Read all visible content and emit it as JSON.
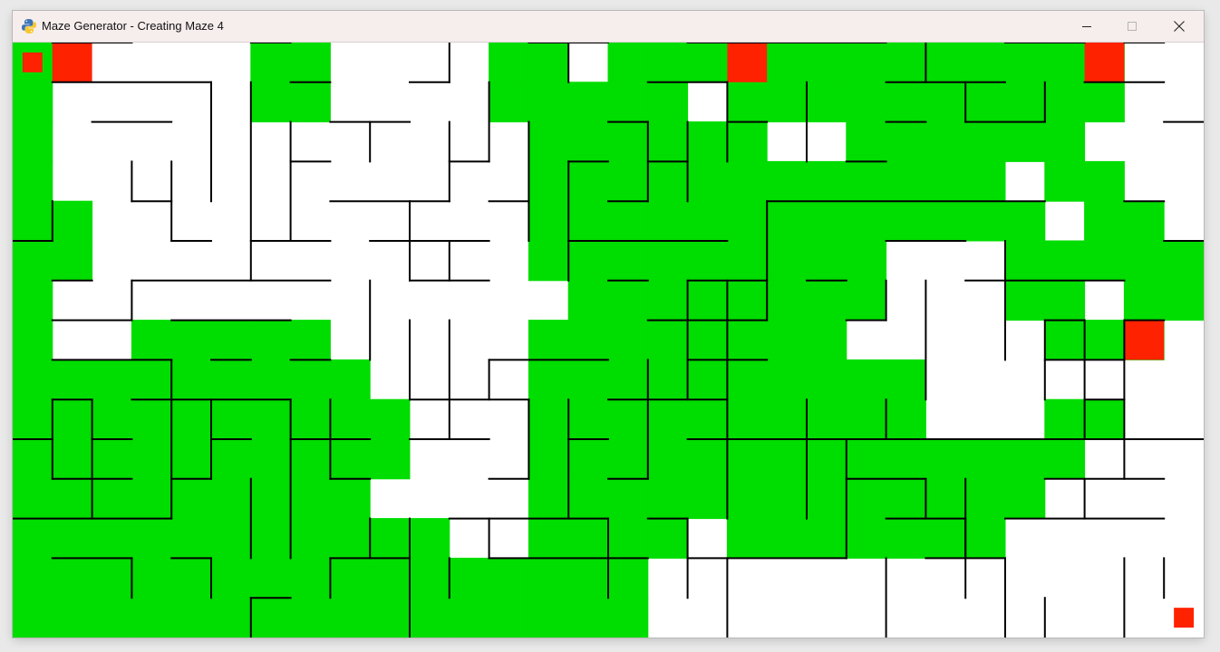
{
  "window": {
    "title": "Maze Generator - Creating Maze 4",
    "app_icon": "python-icon",
    "controls": [
      "minimize-icon",
      "maximize-icon",
      "close-icon"
    ]
  },
  "maze": {
    "columns": 30,
    "rows": 15,
    "colors": {
      "background": "#ffffff",
      "visited": "#00dd00",
      "marker": "#ff2200",
      "wall": "#000000"
    },
    "markers": [
      {
        "kind": "start",
        "col": 0,
        "row": 0,
        "size": "small"
      },
      {
        "kind": "cell",
        "col": 1,
        "row": 0,
        "size": "full"
      },
      {
        "kind": "cell",
        "col": 18,
        "row": 0,
        "size": "full"
      },
      {
        "kind": "cell",
        "col": 27,
        "row": 0,
        "size": "full"
      },
      {
        "kind": "cell",
        "col": 28,
        "row": 7,
        "size": "full"
      },
      {
        "kind": "end",
        "col": 29,
        "row": 14,
        "size": "small"
      }
    ],
    "visited_rows": [
      "G.....GG....GG.GGGGGGGGGGGGG..",
      "G.....GG....GGGGG.GGGGGGGGGG..",
      "G............GGGGGG..GGGGGG...",
      "G............GGGGGGGGGGGG.GG..",
      "GG...........GGGGGGGGGGGGG.GG.",
      "GG...........GGGGGGGGG...GGGGG",
      "G.............GGGGGGGG...GG.GG",
      "G..GGGGG.....GGGGGGGG.....GGG.",
      "GGGGGGGGG....GGGGGGGGGG.......",
      "GGGGGGGGGG...GGGGGGGGGG...GG..",
      "GGGGGGGGGG...GGGGGGGGGGGGGG...",
      "GGGGGGGGG....GGGGGGGGGGGGG....",
      "GGGGGGGGGGG..GGGG.GGGGGGG.....",
      "GGGGGGGGGGGGGGGG..............",
      "GGGGGGGGGGGGGGGG.............."
    ],
    "h_walls": [
      [
        1,
        0,
        3
      ],
      [
        6,
        0,
        7
      ],
      [
        13,
        0,
        15
      ],
      [
        17,
        0,
        20
      ],
      [
        20,
        0,
        22
      ],
      [
        25,
        0,
        27
      ],
      [
        28,
        0,
        29
      ],
      [
        1,
        1,
        5
      ],
      [
        7,
        1,
        8
      ],
      [
        10,
        1,
        11
      ],
      [
        16,
        1,
        18
      ],
      [
        22,
        1,
        25
      ],
      [
        27,
        1,
        29
      ],
      [
        2,
        2,
        4
      ],
      [
        8,
        2,
        10
      ],
      [
        15,
        2,
        16
      ],
      [
        18,
        2,
        19
      ],
      [
        22,
        2,
        23
      ],
      [
        24,
        2,
        26
      ],
      [
        29,
        2,
        30
      ],
      [
        7,
        3,
        8
      ],
      [
        11,
        3,
        12
      ],
      [
        14,
        3,
        15
      ],
      [
        16,
        3,
        17
      ],
      [
        21,
        3,
        22
      ],
      [
        3,
        4,
        4
      ],
      [
        8,
        4,
        11
      ],
      [
        12,
        4,
        13
      ],
      [
        15,
        4,
        16
      ],
      [
        19,
        4,
        26
      ],
      [
        28,
        4,
        29
      ],
      [
        0,
        5,
        1
      ],
      [
        4,
        5,
        5
      ],
      [
        6,
        5,
        8
      ],
      [
        9,
        5,
        12
      ],
      [
        14,
        5,
        18
      ],
      [
        22,
        5,
        24
      ],
      [
        29,
        5,
        30
      ],
      [
        1,
        6,
        2
      ],
      [
        3,
        6,
        8
      ],
      [
        10,
        6,
        12
      ],
      [
        15,
        6,
        16
      ],
      [
        17,
        6,
        19
      ],
      [
        20,
        6,
        21
      ],
      [
        24,
        6,
        28
      ],
      [
        1,
        7,
        3
      ],
      [
        4,
        7,
        7
      ],
      [
        16,
        7,
        19
      ],
      [
        21,
        7,
        22
      ],
      [
        26,
        7,
        27
      ],
      [
        28,
        7,
        29
      ],
      [
        1,
        8,
        4
      ],
      [
        5,
        8,
        6
      ],
      [
        7,
        8,
        8
      ],
      [
        12,
        8,
        15
      ],
      [
        17,
        8,
        19
      ],
      [
        26,
        8,
        28
      ],
      [
        1,
        9,
        2
      ],
      [
        3,
        9,
        7
      ],
      [
        10,
        9,
        13
      ],
      [
        15,
        9,
        18
      ],
      [
        27,
        9,
        28
      ],
      [
        0,
        10,
        1
      ],
      [
        2,
        10,
        3
      ],
      [
        5,
        10,
        6
      ],
      [
        7,
        10,
        9
      ],
      [
        10,
        10,
        12
      ],
      [
        14,
        10,
        15
      ],
      [
        17,
        10,
        23
      ],
      [
        23,
        10,
        26
      ],
      [
        26,
        10,
        27
      ],
      [
        27,
        10,
        28
      ],
      [
        28,
        10,
        30
      ],
      [
        1,
        11,
        3
      ],
      [
        4,
        11,
        5
      ],
      [
        8,
        11,
        9
      ],
      [
        12,
        11,
        13
      ],
      [
        15,
        11,
        16
      ],
      [
        21,
        11,
        23
      ],
      [
        26,
        11,
        29
      ],
      [
        0,
        12,
        4
      ],
      [
        11,
        12,
        15
      ],
      [
        16,
        12,
        17
      ],
      [
        22,
        12,
        24
      ],
      [
        25,
        12,
        29
      ],
      [
        1,
        13,
        3
      ],
      [
        4,
        13,
        5
      ],
      [
        8,
        13,
        10
      ],
      [
        12,
        13,
        16
      ],
      [
        17,
        13,
        21
      ],
      [
        23,
        13,
        25
      ],
      [
        6,
        14,
        7
      ]
    ],
    "v_walls": [
      [
        11,
        0,
        1
      ],
      [
        14,
        0,
        1
      ],
      [
        20,
        1,
        3
      ],
      [
        23,
        0,
        1
      ],
      [
        24,
        1,
        2
      ],
      [
        26,
        1,
        2
      ],
      [
        5,
        1,
        4
      ],
      [
        6,
        1,
        6
      ],
      [
        7,
        2,
        5
      ],
      [
        9,
        2,
        3
      ],
      [
        11,
        2,
        4
      ],
      [
        12,
        1,
        3
      ],
      [
        13,
        2,
        5
      ],
      [
        14,
        3,
        6
      ],
      [
        3,
        3,
        4
      ],
      [
        4,
        3,
        5
      ],
      [
        10,
        4,
        6
      ],
      [
        11,
        5,
        6
      ],
      [
        16,
        2,
        4
      ],
      [
        17,
        2,
        4
      ],
      [
        18,
        1,
        3
      ],
      [
        19,
        4,
        7
      ],
      [
        1,
        4,
        5
      ],
      [
        3,
        6,
        7
      ],
      [
        9,
        6,
        8
      ],
      [
        10,
        7,
        9
      ],
      [
        11,
        7,
        10
      ],
      [
        12,
        8,
        9
      ],
      [
        13,
        9,
        11
      ],
      [
        14,
        9,
        12
      ],
      [
        17,
        6,
        9
      ],
      [
        18,
        6,
        8
      ],
      [
        22,
        6,
        7
      ],
      [
        23,
        6,
        9
      ],
      [
        25,
        5,
        8
      ],
      [
        26,
        7,
        9
      ],
      [
        27,
        7,
        10
      ],
      [
        28,
        7,
        11
      ],
      [
        1,
        9,
        11
      ],
      [
        2,
        9,
        12
      ],
      [
        4,
        8,
        12
      ],
      [
        5,
        9,
        11
      ],
      [
        6,
        11,
        13
      ],
      [
        7,
        9,
        13
      ],
      [
        8,
        9,
        11
      ],
      [
        9,
        12,
        13
      ],
      [
        10,
        12,
        15
      ],
      [
        11,
        13,
        14
      ],
      [
        12,
        12,
        13
      ],
      [
        15,
        12,
        14
      ],
      [
        16,
        8,
        11
      ],
      [
        18,
        8,
        12
      ],
      [
        20,
        9,
        12
      ],
      [
        21,
        10,
        13
      ],
      [
        22,
        9,
        10
      ],
      [
        23,
        11,
        12
      ],
      [
        24,
        11,
        13
      ],
      [
        27,
        11,
        12
      ],
      [
        28,
        13,
        15
      ],
      [
        29,
        13,
        14
      ],
      [
        22,
        13,
        15
      ],
      [
        24,
        12,
        14
      ],
      [
        25,
        13,
        15
      ],
      [
        26,
        14,
        15
      ],
      [
        18,
        13,
        15
      ],
      [
        17,
        12,
        14
      ],
      [
        6,
        14,
        15
      ],
      [
        3,
        13,
        14
      ],
      [
        5,
        13,
        14
      ],
      [
        8,
        13,
        14
      ]
    ]
  }
}
